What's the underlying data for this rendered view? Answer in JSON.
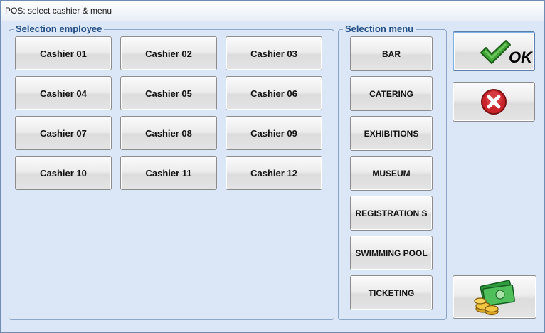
{
  "window": {
    "title": "POS: select cashier & menu"
  },
  "employee_group": {
    "legend": "Selection employee",
    "cashiers": [
      "Cashier 01",
      "Cashier 02",
      "Cashier 03",
      "Cashier 04",
      "Cashier 05",
      "Cashier 06",
      "Cashier 07",
      "Cashier 08",
      "Cashier 09",
      "Cashier 10",
      "Cashier 11",
      "Cashier 12"
    ]
  },
  "menu_group": {
    "legend": "Selection menu",
    "menus": [
      "BAR",
      "CATERING",
      "EXHIBITIONS",
      "MUSEUM",
      "REGISTRATION S",
      "SWIMMING POOL",
      "TICKETING"
    ]
  },
  "actions": {
    "ok_label": "OK",
    "ok_icon": "checkmark-icon",
    "cancel_icon": "red-x-icon",
    "cash_icon": "money-coins-icon"
  },
  "colors": {
    "background": "#dbe7f7",
    "legend_text": "#234f86",
    "check_green": "#3fa534",
    "cancel_red": "#c8242a"
  }
}
